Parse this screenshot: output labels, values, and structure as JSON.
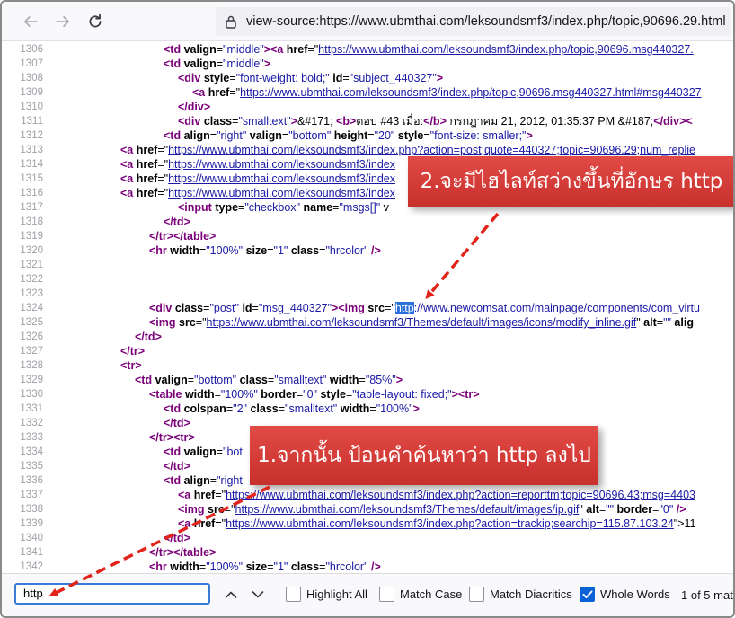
{
  "browser": {
    "url": "view-source:https://www.ubmthai.com/leksoundsmf3/index.php/topic,90696.29.html",
    "icons": {
      "back": "back-arrow-icon",
      "forward": "forward-arrow-icon",
      "reload": "reload-icon",
      "lock": "lock-icon"
    }
  },
  "source_lines": [
    {
      "n": "1306",
      "indent": 180,
      "segs": [
        [
          "tag",
          "<td "
        ],
        [
          "attr",
          "valign"
        ],
        [
          "txt",
          "="
        ],
        [
          "val",
          "\"middle\""
        ],
        [
          "tag",
          ">"
        ],
        [
          "tag",
          "<a "
        ],
        [
          "attr",
          "href"
        ],
        [
          "txt",
          "=\""
        ],
        [
          "lnk",
          "https://www.ubmthai.com/leksoundsmf3/index.php/topic,90696.msg440327."
        ]
      ]
    },
    {
      "n": "1307",
      "indent": 180,
      "segs": [
        [
          "tag",
          "<td "
        ],
        [
          "attr",
          "valign"
        ],
        [
          "txt",
          "="
        ],
        [
          "val",
          "\"middle\""
        ],
        [
          "tag",
          ">"
        ]
      ]
    },
    {
      "n": "1308",
      "indent": 196,
      "segs": [
        [
          "tag",
          "<div "
        ],
        [
          "attr",
          "style"
        ],
        [
          "txt",
          "="
        ],
        [
          "val",
          "\"font-weight: bold;\""
        ],
        [
          "txt",
          " "
        ],
        [
          "attr",
          "id"
        ],
        [
          "txt",
          "="
        ],
        [
          "val",
          "\"subject_440327\""
        ],
        [
          "tag",
          ">"
        ]
      ]
    },
    {
      "n": "1309",
      "indent": 212,
      "segs": [
        [
          "tag",
          "<a "
        ],
        [
          "attr",
          "href"
        ],
        [
          "txt",
          "=\""
        ],
        [
          "lnk",
          "https://www.ubmthai.com/leksoundsmf3/index.php/topic,90696.msg440327.html#msg440327"
        ]
      ]
    },
    {
      "n": "1310",
      "indent": 196,
      "segs": [
        [
          "tag",
          "</div>"
        ]
      ]
    },
    {
      "n": "1311",
      "indent": 196,
      "segs": [
        [
          "tag",
          "<div "
        ],
        [
          "attr",
          "class"
        ],
        [
          "txt",
          "="
        ],
        [
          "val",
          "\"smalltext\""
        ],
        [
          "tag",
          ">"
        ],
        [
          "txt",
          "&#171; "
        ],
        [
          "tag",
          "<b>"
        ],
        [
          "txt",
          "ตอบ #43 เมื่อ:"
        ],
        [
          "tag",
          "</b>"
        ],
        [
          "txt",
          " กรกฎาคม 21, 2012, 01:35:37 PM "
        ],
        [
          "txt",
          "&#187;"
        ],
        [
          "tag",
          "</div>"
        ],
        [
          "tag",
          "<"
        ]
      ]
    },
    {
      "n": "1312",
      "indent": 180,
      "segs": [
        [
          "tag",
          "<td "
        ],
        [
          "attr",
          "align"
        ],
        [
          "txt",
          "="
        ],
        [
          "val",
          "\"right\""
        ],
        [
          "txt",
          " "
        ],
        [
          "attr",
          "valign"
        ],
        [
          "txt",
          "="
        ],
        [
          "val",
          "\"bottom\""
        ],
        [
          "txt",
          " "
        ],
        [
          "attr",
          "height"
        ],
        [
          "txt",
          "="
        ],
        [
          "val",
          "\"20\""
        ],
        [
          "txt",
          " "
        ],
        [
          "attr",
          "style"
        ],
        [
          "txt",
          "="
        ],
        [
          "val",
          "\"font-size: smaller;\""
        ],
        [
          "tag",
          ">"
        ]
      ]
    },
    {
      "n": "1313",
      "indent": 132,
      "segs": [
        [
          "tag",
          "<a "
        ],
        [
          "attr",
          "href"
        ],
        [
          "txt",
          "=\""
        ],
        [
          "lnk",
          "https://www.ubmthai.com/leksoundsmf3/index.php?action=post;quote=440327;topic=90696.29;num_replie"
        ]
      ]
    },
    {
      "n": "1314",
      "indent": 132,
      "segs": [
        [
          "tag",
          "<a "
        ],
        [
          "attr",
          "href"
        ],
        [
          "txt",
          "=\""
        ],
        [
          "lnk",
          "https://www.ubmthai.com/leksoundsmf3/index"
        ]
      ]
    },
    {
      "n": "1315",
      "indent": 132,
      "segs": [
        [
          "tag",
          "<a "
        ],
        [
          "attr",
          "href"
        ],
        [
          "txt",
          "=\""
        ],
        [
          "lnk",
          "https://www.ubmthai.com/leksoundsmf3/index"
        ]
      ]
    },
    {
      "n": "1316",
      "indent": 132,
      "segs": [
        [
          "tag",
          "<a "
        ],
        [
          "attr",
          "href"
        ],
        [
          "txt",
          "=\""
        ],
        [
          "lnk",
          "https://www.ubmthai.com/leksoundsmf3/index"
        ]
      ]
    },
    {
      "n": "1317",
      "indent": 196,
      "segs": [
        [
          "tag",
          "<input "
        ],
        [
          "attr",
          "type"
        ],
        [
          "txt",
          "="
        ],
        [
          "val",
          "\"checkbox\""
        ],
        [
          "txt",
          " "
        ],
        [
          "attr",
          "name"
        ],
        [
          "txt",
          "="
        ],
        [
          "val",
          "\"msgs[]\""
        ],
        [
          "txt",
          " v"
        ]
      ]
    },
    {
      "n": "1318",
      "indent": 180,
      "segs": [
        [
          "tag",
          "</td>"
        ]
      ]
    },
    {
      "n": "1319",
      "indent": 164,
      "segs": [
        [
          "tag",
          "</tr></table>"
        ]
      ]
    },
    {
      "n": "1320",
      "indent": 164,
      "segs": [
        [
          "tag",
          "<hr "
        ],
        [
          "attr",
          "width"
        ],
        [
          "txt",
          "="
        ],
        [
          "val",
          "\"100%\""
        ],
        [
          "txt",
          " "
        ],
        [
          "attr",
          "size"
        ],
        [
          "txt",
          "="
        ],
        [
          "val",
          "\"1\""
        ],
        [
          "txt",
          " "
        ],
        [
          "attr",
          "class"
        ],
        [
          "txt",
          "="
        ],
        [
          "val",
          "\"hrcolor\""
        ],
        [
          "txt",
          " "
        ],
        [
          "tag",
          "/>"
        ]
      ]
    },
    {
      "n": "1321",
      "indent": 0,
      "segs": []
    },
    {
      "n": "1322",
      "indent": 0,
      "segs": []
    },
    {
      "n": "1323",
      "indent": 0,
      "segs": []
    },
    {
      "n": "1324",
      "indent": 164,
      "segs": [
        [
          "tag",
          "<div "
        ],
        [
          "attr",
          "class"
        ],
        [
          "txt",
          "="
        ],
        [
          "val",
          "\"post\""
        ],
        [
          "txt",
          " "
        ],
        [
          "attr",
          "id"
        ],
        [
          "txt",
          "="
        ],
        [
          "val",
          "\"msg_440327\""
        ],
        [
          "tag",
          ">"
        ],
        [
          "tag",
          "<img "
        ],
        [
          "attr",
          "src"
        ],
        [
          "txt",
          "=\""
        ],
        [
          "hl",
          "http"
        ],
        [
          "lnk",
          "://www.newcomsat.com/mainpage/components/com_virtu"
        ]
      ]
    },
    {
      "n": "1325",
      "indent": 164,
      "segs": [
        [
          "tag",
          "<img "
        ],
        [
          "attr",
          "src"
        ],
        [
          "txt",
          "=\""
        ],
        [
          "lnk",
          "https://www.ubmthai.com/leksoundsmf3/Themes/default/images/icons/modify_inline.gif"
        ],
        [
          "txt",
          "\" "
        ],
        [
          "attr",
          "alt"
        ],
        [
          "txt",
          "="
        ],
        [
          "val",
          "\"\""
        ],
        [
          "txt",
          " "
        ],
        [
          "attr",
          "alig"
        ]
      ]
    },
    {
      "n": "1326",
      "indent": 148,
      "segs": [
        [
          "tag",
          "</td>"
        ]
      ]
    },
    {
      "n": "1327",
      "indent": 132,
      "segs": [
        [
          "tag",
          "</tr>"
        ]
      ]
    },
    {
      "n": "1328",
      "indent": 132,
      "segs": [
        [
          "tag",
          "<tr>"
        ]
      ]
    },
    {
      "n": "1329",
      "indent": 148,
      "segs": [
        [
          "tag",
          "<td "
        ],
        [
          "attr",
          "valign"
        ],
        [
          "txt",
          "="
        ],
        [
          "val",
          "\"bottom\""
        ],
        [
          "txt",
          " "
        ],
        [
          "attr",
          "class"
        ],
        [
          "txt",
          "="
        ],
        [
          "val",
          "\"smalltext\""
        ],
        [
          "txt",
          " "
        ],
        [
          "attr",
          "width"
        ],
        [
          "txt",
          "="
        ],
        [
          "val",
          "\"85%\""
        ],
        [
          "tag",
          ">"
        ]
      ]
    },
    {
      "n": "1330",
      "indent": 164,
      "segs": [
        [
          "tag",
          "<table "
        ],
        [
          "attr",
          "width"
        ],
        [
          "txt",
          "="
        ],
        [
          "val",
          "\"100%\""
        ],
        [
          "txt",
          " "
        ],
        [
          "attr",
          "border"
        ],
        [
          "txt",
          "="
        ],
        [
          "val",
          "\"0\""
        ],
        [
          "txt",
          " "
        ],
        [
          "attr",
          "style"
        ],
        [
          "txt",
          "="
        ],
        [
          "val",
          "\"table-layout: fixed;\""
        ],
        [
          "tag",
          ">"
        ],
        [
          "tag",
          "<tr>"
        ]
      ]
    },
    {
      "n": "1331",
      "indent": 180,
      "segs": [
        [
          "tag",
          "<td "
        ],
        [
          "attr",
          "colspan"
        ],
        [
          "txt",
          "="
        ],
        [
          "val",
          "\"2\""
        ],
        [
          "txt",
          " "
        ],
        [
          "attr",
          "class"
        ],
        [
          "txt",
          "="
        ],
        [
          "val",
          "\"smalltext\""
        ],
        [
          "txt",
          " "
        ],
        [
          "attr",
          "width"
        ],
        [
          "txt",
          "="
        ],
        [
          "val",
          "\"100%\""
        ],
        [
          "tag",
          ">"
        ]
      ]
    },
    {
      "n": "1332",
      "indent": 180,
      "segs": [
        [
          "tag",
          "</td>"
        ]
      ]
    },
    {
      "n": "1333",
      "indent": 164,
      "segs": [
        [
          "tag",
          "</tr><tr>"
        ]
      ]
    },
    {
      "n": "1334",
      "indent": 180,
      "segs": [
        [
          "tag",
          "<td "
        ],
        [
          "attr",
          "valign"
        ],
        [
          "txt",
          "="
        ],
        [
          "val",
          "\"bot"
        ]
      ]
    },
    {
      "n": "1335",
      "indent": 180,
      "segs": [
        [
          "tag",
          "</td>"
        ]
      ]
    },
    {
      "n": "1336",
      "indent": 180,
      "segs": [
        [
          "tag",
          "<td "
        ],
        [
          "attr",
          "align"
        ],
        [
          "txt",
          "="
        ],
        [
          "val",
          "\"right"
        ]
      ]
    },
    {
      "n": "1337",
      "indent": 196,
      "segs": [
        [
          "tag",
          "<a "
        ],
        [
          "attr",
          "href"
        ],
        [
          "txt",
          "=\""
        ],
        [
          "lnk",
          "https://www.ubmthai.com/leksoundsmf3/index.php?action=reporttm;topic=90696.43;msg=4403"
        ]
      ]
    },
    {
      "n": "1338",
      "indent": 196,
      "segs": [
        [
          "tag",
          "<img "
        ],
        [
          "attr",
          "src"
        ],
        [
          "txt",
          "=\""
        ],
        [
          "lnk",
          "https://www.ubmthai.com/leksoundsmf3/Themes/default/images/ip.gif"
        ],
        [
          "txt",
          "\" "
        ],
        [
          "attr",
          "alt"
        ],
        [
          "txt",
          "="
        ],
        [
          "val",
          "\"\""
        ],
        [
          "txt",
          " "
        ],
        [
          "attr",
          "border"
        ],
        [
          "txt",
          "="
        ],
        [
          "val",
          "\"0\""
        ],
        [
          "txt",
          " "
        ],
        [
          "tag",
          "/>"
        ]
      ]
    },
    {
      "n": "1339",
      "indent": 196,
      "segs": [
        [
          "tag",
          "<a "
        ],
        [
          "attr",
          "href"
        ],
        [
          "txt",
          "=\""
        ],
        [
          "lnk",
          "https://www.ubmthai.com/leksoundsmf3/index.php?action=trackip;searchip=115.87.103.24"
        ],
        [
          "txt",
          "\">11"
        ]
      ]
    },
    {
      "n": "1340",
      "indent": 180,
      "segs": [
        [
          "tag",
          "</td>"
        ]
      ]
    },
    {
      "n": "1341",
      "indent": 164,
      "segs": [
        [
          "tag",
          "</tr></table>"
        ]
      ]
    },
    {
      "n": "1342",
      "indent": 164,
      "segs": [
        [
          "tag",
          "<hr "
        ],
        [
          "attr",
          "width"
        ],
        [
          "txt",
          "="
        ],
        [
          "val",
          "\"100%\""
        ],
        [
          "txt",
          " "
        ],
        [
          "attr",
          "size"
        ],
        [
          "txt",
          "="
        ],
        [
          "val",
          "\"1\""
        ],
        [
          "txt",
          " "
        ],
        [
          "attr",
          "class"
        ],
        [
          "txt",
          "="
        ],
        [
          "val",
          "\"hrcolor\""
        ],
        [
          "txt",
          " "
        ],
        [
          "tag",
          "/>"
        ]
      ]
    }
  ],
  "callouts": {
    "step2": "2.จะมีไฮไลท์สว่างขึ้นที่อักษร http",
    "step1": "1.จากนั้น ป้อนคำค้นหาว่า http ลงไป"
  },
  "findbar": {
    "query": "http",
    "highlight_all": "Highlight All",
    "match_case": "Match Case",
    "match_diacritics": "Match Diacritics",
    "whole_words": "Whole Words",
    "whole_words_checked": true,
    "match_count": "1 of 5 mat",
    "icons": {
      "prev": "chevron-up-icon",
      "next": "chevron-down-icon",
      "check": "checkmark-icon"
    }
  },
  "colors": {
    "callout_red": "#d23a37",
    "tag": "#7a007a",
    "value": "#1a1aa6",
    "highlight": "#2a6fdb",
    "accent": "#0a62d6"
  }
}
